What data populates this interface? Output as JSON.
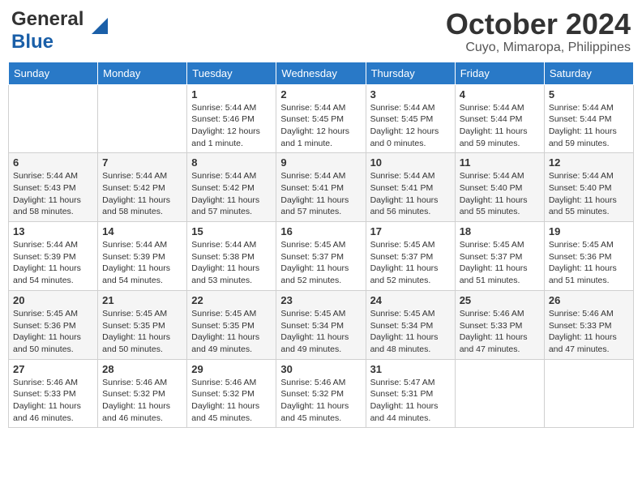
{
  "header": {
    "logo_general": "General",
    "logo_blue": "Blue",
    "month_title": "October 2024",
    "location": "Cuyo, Mimaropa, Philippines"
  },
  "days_of_week": [
    "Sunday",
    "Monday",
    "Tuesday",
    "Wednesday",
    "Thursday",
    "Friday",
    "Saturday"
  ],
  "weeks": [
    [
      {
        "day": "",
        "sunrise": "",
        "sunset": "",
        "daylight": ""
      },
      {
        "day": "",
        "sunrise": "",
        "sunset": "",
        "daylight": ""
      },
      {
        "day": "1",
        "sunrise": "Sunrise: 5:44 AM",
        "sunset": "Sunset: 5:46 PM",
        "daylight": "Daylight: 12 hours and 1 minute."
      },
      {
        "day": "2",
        "sunrise": "Sunrise: 5:44 AM",
        "sunset": "Sunset: 5:45 PM",
        "daylight": "Daylight: 12 hours and 1 minute."
      },
      {
        "day": "3",
        "sunrise": "Sunrise: 5:44 AM",
        "sunset": "Sunset: 5:45 PM",
        "daylight": "Daylight: 12 hours and 0 minutes."
      },
      {
        "day": "4",
        "sunrise": "Sunrise: 5:44 AM",
        "sunset": "Sunset: 5:44 PM",
        "daylight": "Daylight: 11 hours and 59 minutes."
      },
      {
        "day": "5",
        "sunrise": "Sunrise: 5:44 AM",
        "sunset": "Sunset: 5:44 PM",
        "daylight": "Daylight: 11 hours and 59 minutes."
      }
    ],
    [
      {
        "day": "6",
        "sunrise": "Sunrise: 5:44 AM",
        "sunset": "Sunset: 5:43 PM",
        "daylight": "Daylight: 11 hours and 58 minutes."
      },
      {
        "day": "7",
        "sunrise": "Sunrise: 5:44 AM",
        "sunset": "Sunset: 5:42 PM",
        "daylight": "Daylight: 11 hours and 58 minutes."
      },
      {
        "day": "8",
        "sunrise": "Sunrise: 5:44 AM",
        "sunset": "Sunset: 5:42 PM",
        "daylight": "Daylight: 11 hours and 57 minutes."
      },
      {
        "day": "9",
        "sunrise": "Sunrise: 5:44 AM",
        "sunset": "Sunset: 5:41 PM",
        "daylight": "Daylight: 11 hours and 57 minutes."
      },
      {
        "day": "10",
        "sunrise": "Sunrise: 5:44 AM",
        "sunset": "Sunset: 5:41 PM",
        "daylight": "Daylight: 11 hours and 56 minutes."
      },
      {
        "day": "11",
        "sunrise": "Sunrise: 5:44 AM",
        "sunset": "Sunset: 5:40 PM",
        "daylight": "Daylight: 11 hours and 55 minutes."
      },
      {
        "day": "12",
        "sunrise": "Sunrise: 5:44 AM",
        "sunset": "Sunset: 5:40 PM",
        "daylight": "Daylight: 11 hours and 55 minutes."
      }
    ],
    [
      {
        "day": "13",
        "sunrise": "Sunrise: 5:44 AM",
        "sunset": "Sunset: 5:39 PM",
        "daylight": "Daylight: 11 hours and 54 minutes."
      },
      {
        "day": "14",
        "sunrise": "Sunrise: 5:44 AM",
        "sunset": "Sunset: 5:39 PM",
        "daylight": "Daylight: 11 hours and 54 minutes."
      },
      {
        "day": "15",
        "sunrise": "Sunrise: 5:44 AM",
        "sunset": "Sunset: 5:38 PM",
        "daylight": "Daylight: 11 hours and 53 minutes."
      },
      {
        "day": "16",
        "sunrise": "Sunrise: 5:45 AM",
        "sunset": "Sunset: 5:37 PM",
        "daylight": "Daylight: 11 hours and 52 minutes."
      },
      {
        "day": "17",
        "sunrise": "Sunrise: 5:45 AM",
        "sunset": "Sunset: 5:37 PM",
        "daylight": "Daylight: 11 hours and 52 minutes."
      },
      {
        "day": "18",
        "sunrise": "Sunrise: 5:45 AM",
        "sunset": "Sunset: 5:37 PM",
        "daylight": "Daylight: 11 hours and 51 minutes."
      },
      {
        "day": "19",
        "sunrise": "Sunrise: 5:45 AM",
        "sunset": "Sunset: 5:36 PM",
        "daylight": "Daylight: 11 hours and 51 minutes."
      }
    ],
    [
      {
        "day": "20",
        "sunrise": "Sunrise: 5:45 AM",
        "sunset": "Sunset: 5:36 PM",
        "daylight": "Daylight: 11 hours and 50 minutes."
      },
      {
        "day": "21",
        "sunrise": "Sunrise: 5:45 AM",
        "sunset": "Sunset: 5:35 PM",
        "daylight": "Daylight: 11 hours and 50 minutes."
      },
      {
        "day": "22",
        "sunrise": "Sunrise: 5:45 AM",
        "sunset": "Sunset: 5:35 PM",
        "daylight": "Daylight: 11 hours and 49 minutes."
      },
      {
        "day": "23",
        "sunrise": "Sunrise: 5:45 AM",
        "sunset": "Sunset: 5:34 PM",
        "daylight": "Daylight: 11 hours and 49 minutes."
      },
      {
        "day": "24",
        "sunrise": "Sunrise: 5:45 AM",
        "sunset": "Sunset: 5:34 PM",
        "daylight": "Daylight: 11 hours and 48 minutes."
      },
      {
        "day": "25",
        "sunrise": "Sunrise: 5:46 AM",
        "sunset": "Sunset: 5:33 PM",
        "daylight": "Daylight: 11 hours and 47 minutes."
      },
      {
        "day": "26",
        "sunrise": "Sunrise: 5:46 AM",
        "sunset": "Sunset: 5:33 PM",
        "daylight": "Daylight: 11 hours and 47 minutes."
      }
    ],
    [
      {
        "day": "27",
        "sunrise": "Sunrise: 5:46 AM",
        "sunset": "Sunset: 5:33 PM",
        "daylight": "Daylight: 11 hours and 46 minutes."
      },
      {
        "day": "28",
        "sunrise": "Sunrise: 5:46 AM",
        "sunset": "Sunset: 5:32 PM",
        "daylight": "Daylight: 11 hours and 46 minutes."
      },
      {
        "day": "29",
        "sunrise": "Sunrise: 5:46 AM",
        "sunset": "Sunset: 5:32 PM",
        "daylight": "Daylight: 11 hours and 45 minutes."
      },
      {
        "day": "30",
        "sunrise": "Sunrise: 5:46 AM",
        "sunset": "Sunset: 5:32 PM",
        "daylight": "Daylight: 11 hours and 45 minutes."
      },
      {
        "day": "31",
        "sunrise": "Sunrise: 5:47 AM",
        "sunset": "Sunset: 5:31 PM",
        "daylight": "Daylight: 11 hours and 44 minutes."
      },
      {
        "day": "",
        "sunrise": "",
        "sunset": "",
        "daylight": ""
      },
      {
        "day": "",
        "sunrise": "",
        "sunset": "",
        "daylight": ""
      }
    ]
  ]
}
